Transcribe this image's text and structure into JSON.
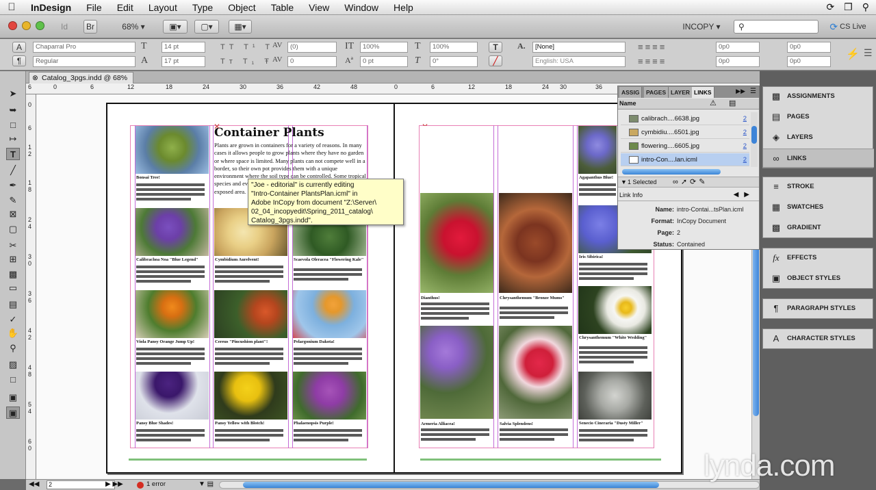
{
  "menubar": {
    "app": "InDesign",
    "items": [
      "File",
      "Edit",
      "Layout",
      "Type",
      "Object",
      "Table",
      "View",
      "Window",
      "Help"
    ]
  },
  "appbar": {
    "zoom": "68%",
    "workspace": "INCOPY ▾",
    "cs_live": "CS Live"
  },
  "control": {
    "font_family": "Chaparral Pro",
    "font_style": "Regular",
    "size": "14 pt",
    "leading": "17 pt",
    "kerning": "(0)",
    "tracking": "0",
    "vscale": "100%",
    "hscale": "100%",
    "baseline": "0 pt",
    "skew": "0°",
    "char_style": "[None]",
    "language": "English: USA",
    "indent1": "0p0",
    "indent2": "0p0",
    "indent3": "0p0",
    "indent4": "0p0"
  },
  "doc_tab": "Catalog_3pgs.indd @ 68%",
  "ruler": {
    "h": [
      "6",
      "0",
      "6",
      "12",
      "18",
      "24",
      "30",
      "36",
      "42",
      "48",
      "0",
      "6",
      "12",
      "18",
      "24",
      "30",
      "36"
    ],
    "v": [
      "0",
      "6",
      "1",
      "2",
      "1",
      "8",
      "2",
      "4",
      "3",
      "0",
      "3",
      "6",
      "4",
      "2",
      "4",
      "8",
      "5",
      "4",
      "6",
      "0"
    ]
  },
  "page": {
    "headline": "Container Plants",
    "body": "Plants are grown in containers for a variety of reasons. In many cases it allows people to grow plants where they have no garden or where space is limited. Many plants can not compete well in a border, so their own pot provides them with a unique environment where the soil type can be controlled. Some tropical species and even those that are tender can be grown in an exposed area."
  },
  "plants_left": [
    {
      "name": "Bonsai Tree!"
    },
    {
      "name": "Calibrachoa Noa \"Blue Legend\""
    },
    {
      "name": "Cymbidium Aurelvent!"
    },
    {
      "name": "Scaevola Oleracea \"Flowering Kale\""
    },
    {
      "name": "Viola Pansy Orange Jump Up!"
    },
    {
      "name": "Cereus \"Pincushion plant\"!"
    },
    {
      "name": "Pelargonium Dakota!"
    },
    {
      "name": "Pansy Blue Shades!"
    },
    {
      "name": "Pansy Yellow with Blotch!"
    },
    {
      "name": "Phalaenopsis Purple!"
    }
  ],
  "plants_right": [
    {
      "name": "Agapanthus Blue!"
    },
    {
      "name": "Iris Sibirica!"
    },
    {
      "name": "Dianthus!"
    },
    {
      "name": "Chrysanthemum \"Bronze Mums\""
    },
    {
      "name": "Chrysanthemum \"White Wedding\""
    },
    {
      "name": "Armeria Alliacea!"
    },
    {
      "name": "Salvia Splendens!"
    },
    {
      "name": "Senecio Cineraria \"Dusty Miller\""
    }
  ],
  "tooltip": {
    "lines": [
      "\"Joe - editorial\" is currently editing",
      "\"Intro-Container PlantsPlan.icml\" in",
      "Adobe InCopy from document \"Z:\\Server\\",
      "02_04_incopyedit\\Spring_2011_catalog\\",
      "Catalog_3pgs.indd\"."
    ]
  },
  "links_panel": {
    "tabs": [
      "ASSIG",
      "PAGES",
      "LAYER",
      "LINKS"
    ],
    "col_name": "Name",
    "rows": [
      {
        "name": "calibrach....6638.jpg",
        "page": "2"
      },
      {
        "name": "cymbidiu....6501.jpg",
        "page": "2"
      },
      {
        "name": "flowering....6605.jpg",
        "page": "2"
      },
      {
        "name": "intro-Con....lan.icml",
        "page": "2"
      }
    ],
    "selected": "1 Selected",
    "info_title": "Link Info",
    "info": [
      {
        "k": "Name:",
        "v": "intro-Contai...tsPlan.icml"
      },
      {
        "k": "Format:",
        "v": "InCopy Document"
      },
      {
        "k": "Page:",
        "v": "2"
      },
      {
        "k": "Status:",
        "v": "Contained"
      }
    ]
  },
  "dock": {
    "group1": [
      "ASSIGNMENTS",
      "PAGES",
      "LAYERS",
      "LINKS"
    ],
    "group2": [
      "STROKE",
      "SWATCHES",
      "GRADIENT"
    ],
    "group3": [
      "EFFECTS",
      "OBJECT STYLES"
    ],
    "group4": [
      "PARAGRAPH STYLES"
    ],
    "group5": [
      "CHARACTER STYLES"
    ]
  },
  "status": {
    "page": "2",
    "errors": "1 error"
  },
  "watermark": "lynda.com",
  "colors": {
    "guide": "#c36bd6",
    "bleed": "#e87fb4",
    "tooltip": "#fffec8",
    "link_blue": "#2a55c8"
  }
}
